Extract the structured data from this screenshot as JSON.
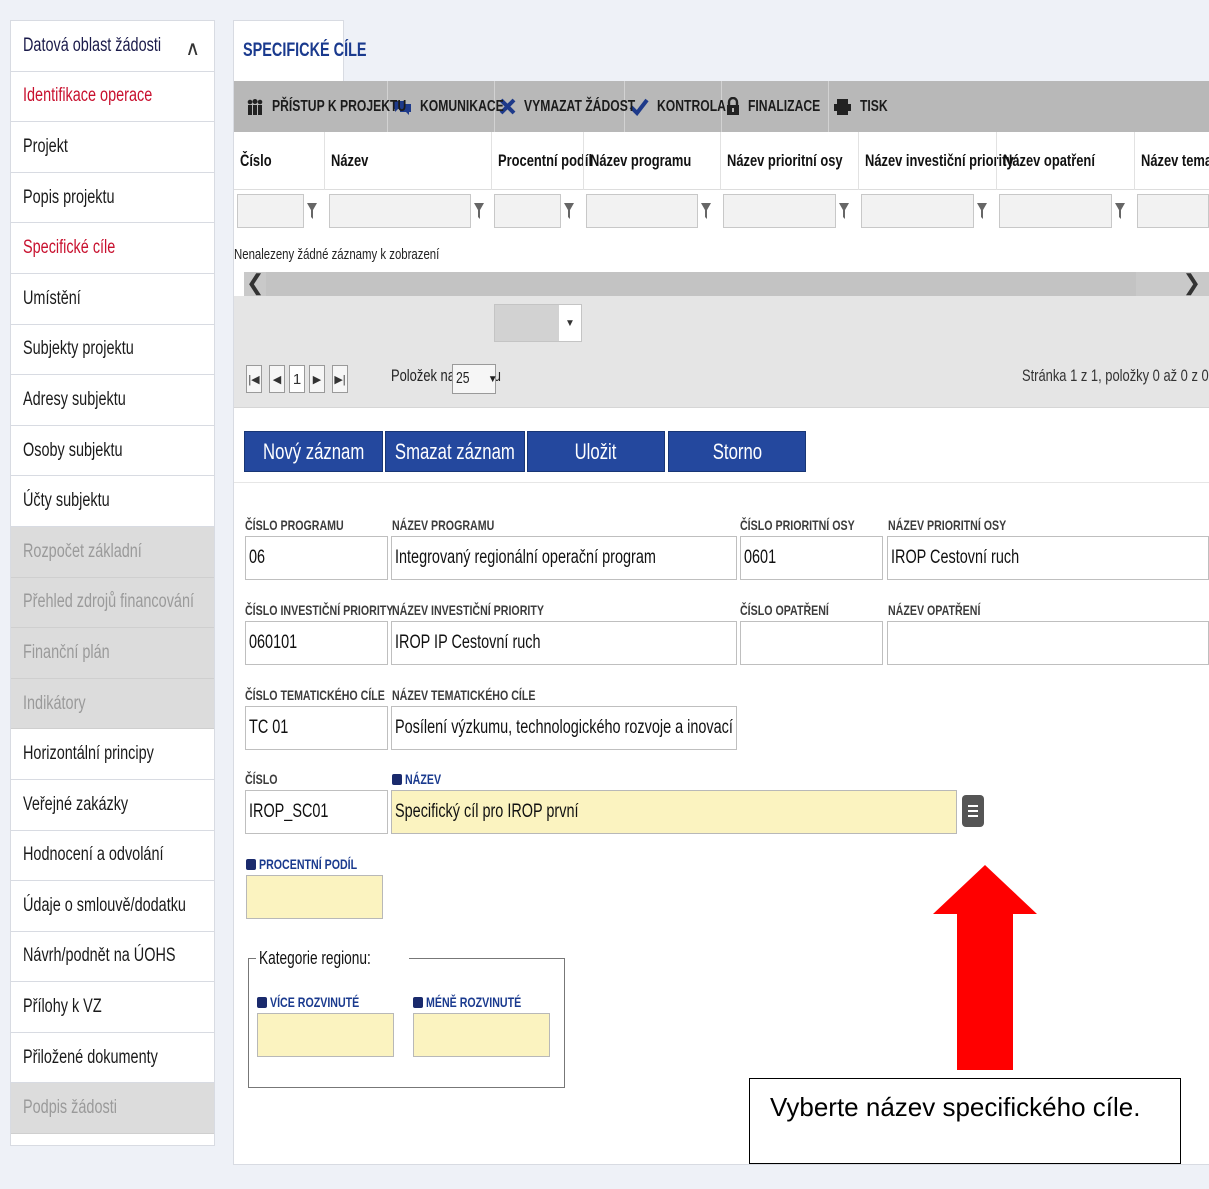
{
  "sidebar": {
    "header": "Datová oblast žádosti",
    "items": [
      {
        "label": "Identifikace operace",
        "state": "active"
      },
      {
        "label": "Projekt",
        "state": "normal"
      },
      {
        "label": "Popis projektu",
        "state": "normal"
      },
      {
        "label": "Specifické cíle",
        "state": "active"
      },
      {
        "label": "Umístění",
        "state": "normal"
      },
      {
        "label": "Subjekty projektu",
        "state": "normal"
      },
      {
        "label": "Adresy subjektu",
        "state": "normal"
      },
      {
        "label": "Osoby subjektu",
        "state": "normal"
      },
      {
        "label": "Účty subjektu",
        "state": "normal"
      },
      {
        "label": "Rozpočet základní",
        "state": "disabled"
      },
      {
        "label": "Přehled zdrojů financování",
        "state": "disabled"
      },
      {
        "label": "Finanční plán",
        "state": "disabled"
      },
      {
        "label": "Indikátory",
        "state": "disabled"
      },
      {
        "label": "Horizontální principy",
        "state": "normal"
      },
      {
        "label": "Veřejné zakázky",
        "state": "normal"
      },
      {
        "label": "Hodnocení a odvolání",
        "state": "normal"
      },
      {
        "label": "Údaje o smlouvě/dodatku",
        "state": "normal"
      },
      {
        "label": "Návrh/podnět na ÚOHS",
        "state": "normal"
      },
      {
        "label": "Přílohy k VZ",
        "state": "normal"
      },
      {
        "label": "Přiložené dokumenty",
        "state": "normal"
      },
      {
        "label": "Podpis žádosti",
        "state": "disabled"
      }
    ]
  },
  "tab": {
    "label": "SPECIFICKÉ CÍLE"
  },
  "toolbar": {
    "access": "PŘÍSTUP K PROJEKTU",
    "communication": "KOMUNIKACE",
    "delete_request": "VYMAZAT ŽÁDOST",
    "check": "KONTROLA",
    "finalize": "FINALIZACE",
    "print": "TISK"
  },
  "grid": {
    "columns": [
      "Číslo",
      "Název",
      "Procentní podíl",
      "Název programu",
      "Název prioritní osy",
      "Název investiční priority",
      "Název opatření",
      "Název tematického"
    ],
    "empty_message": "Nenalezeny žádné záznamy k zobrazení"
  },
  "pager": {
    "current_page": "1",
    "page_size_label": "Položek na stránku",
    "page_size": "25",
    "info": "Stránka 1 z 1, položky 0 až 0 z 0"
  },
  "actions": {
    "new": "Nový záznam",
    "delete": "Smazat záznam",
    "save": "Uložit",
    "cancel": "Storno"
  },
  "form": {
    "program_number": {
      "label": "Číslo programu",
      "value": "06"
    },
    "program_name": {
      "label": "Název programu",
      "value": "Integrovaný regionální operační program"
    },
    "axis_number": {
      "label": "Číslo prioritní osy",
      "value": "0601"
    },
    "axis_name": {
      "label": "Název prioritní osy",
      "value": "IROP Cestovní ruch"
    },
    "priority_number": {
      "label": "Číslo investiční priority",
      "value": "060101"
    },
    "priority_name": {
      "label": "Název investiční priority",
      "value": "IROP IP Cestovní ruch"
    },
    "measure_number": {
      "label": "Číslo opatření",
      "value": ""
    },
    "measure_name": {
      "label": "Název opatření",
      "value": ""
    },
    "theme_number": {
      "label": "Číslo tematického cíle",
      "value": "TC 01"
    },
    "theme_name": {
      "label": "Název tematického cíle",
      "value": "Posílení výzkumu, technologického rozvoje a inovací"
    },
    "number": {
      "label": "Číslo",
      "value": "IROP_SC01"
    },
    "name": {
      "label": "Název",
      "value": "Specifický cíl pro IROP první"
    },
    "percent": {
      "label": "Procentní podíl",
      "value": ""
    },
    "region": {
      "legend": "Kategorie regionu:",
      "more_developed": {
        "label": "Více rozvinuté",
        "value": ""
      },
      "less_developed": {
        "label": "Méně rozvinuté",
        "value": ""
      }
    }
  },
  "annotation": {
    "text": "Vyberte název specifického cíle.",
    "arrow_color": "#ff0000"
  },
  "colors": {
    "accent": "#24489e",
    "active_nav": "#c8102e",
    "required_field": "#fbf3c0"
  }
}
